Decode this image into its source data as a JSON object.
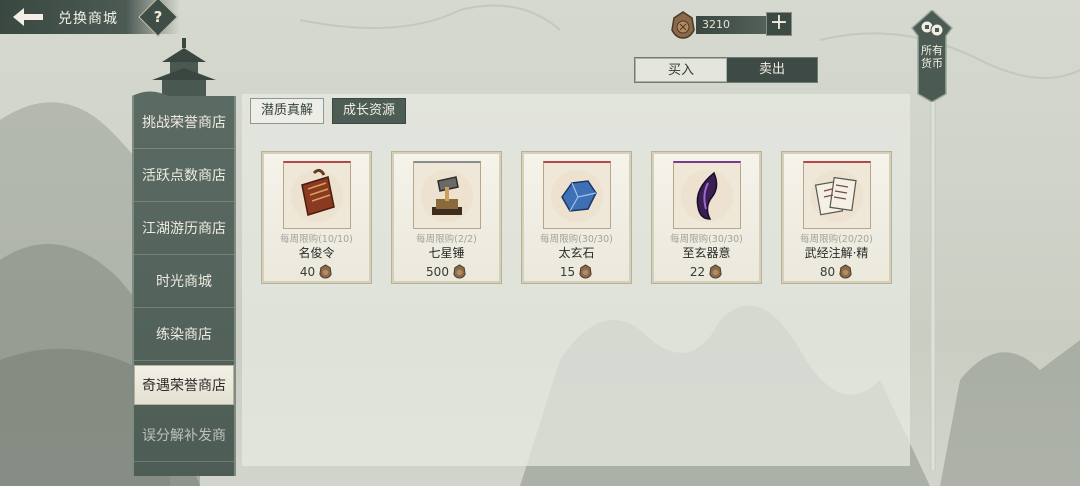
{
  "header": {
    "title": "兑换商城",
    "help_label": "?"
  },
  "currency": {
    "icon": "coin-pouch-icon",
    "amount": "3210",
    "add_label": "+"
  },
  "trade_tabs": {
    "buy_label": "买入",
    "sell_label": "卖出",
    "selected": "卖出"
  },
  "all_currency": {
    "label": "所有货币"
  },
  "sidebar": {
    "items": [
      {
        "label": "挑战荣誉商店"
      },
      {
        "label": "活跃点数商店"
      },
      {
        "label": "江湖游历商店"
      },
      {
        "label": "时光商城"
      },
      {
        "label": "练染商店"
      },
      {
        "label": "奇遇荣誉商店"
      },
      {
        "label": "误分解补发商"
      }
    ],
    "selected": "奇遇荣誉商店"
  },
  "sub_tabs": {
    "tab1": "潜质真解",
    "tab2": "成长资源",
    "selected": "成长资源"
  },
  "items": [
    {
      "limit": "每周限购(10/10)",
      "name": "名俊令",
      "price": "40",
      "icon": "scroll-token-icon",
      "rarity_color": "#b5484b"
    },
    {
      "limit": "每周限购(2/2)",
      "name": "七星锤",
      "price": "500",
      "icon": "hammer-icon",
      "rarity_color": "#8c8c8c"
    },
    {
      "limit": "每周限购(30/30)",
      "name": "太玄石",
      "price": "15",
      "icon": "blue-stone-icon",
      "rarity_color": "#b5484b"
    },
    {
      "limit": "每周限购(30/30)",
      "name": "至玄器意",
      "price": "22",
      "icon": "purple-essence-icon",
      "rarity_color": "#7a3b8a"
    },
    {
      "limit": "每周限购(20/20)",
      "name": "武经注解·精",
      "price": "80",
      "icon": "scripture-cards-icon",
      "rarity_color": "#b5484b"
    }
  ],
  "colors": {
    "panel_dark": "#4e5c56",
    "accent_red": "#b5484b",
    "paper": "#f3f0e6"
  }
}
